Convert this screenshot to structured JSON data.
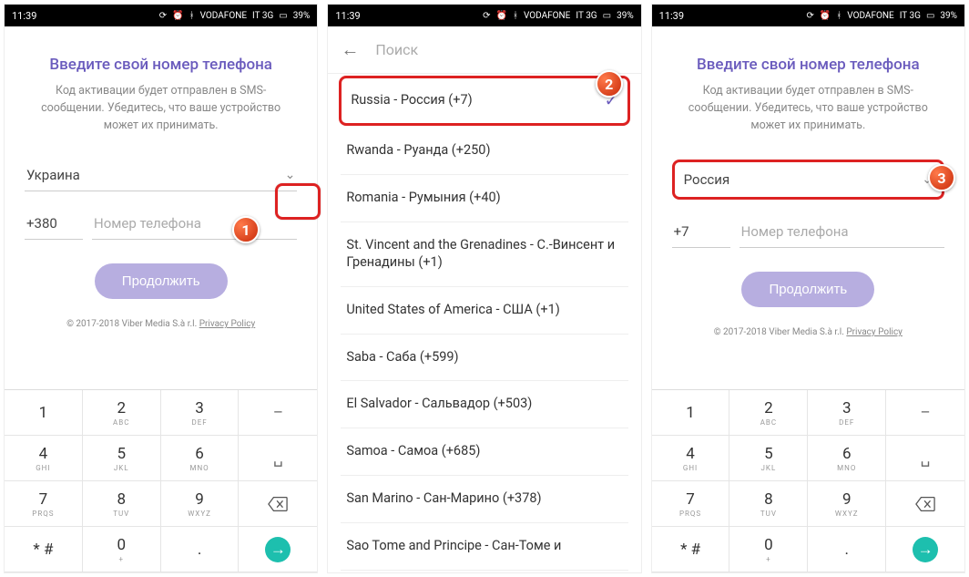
{
  "status": {
    "time": "11:39",
    "carrier": "VODAFONE",
    "network": "IT 3G",
    "battery": "39%"
  },
  "screen1": {
    "title": "Введите свой номер телефона",
    "subtitle": "Код активации будет отправлен в SMS-сообщении. Убедитесь, что ваше устройство может их принимать.",
    "country": "Украина",
    "code": "+380",
    "phone_placeholder": "Номер телефона",
    "continue": "Продолжить",
    "copyright": "© 2017-2018 Viber Media S.à r.l.",
    "privacy": "Privacy Policy",
    "badge": "1"
  },
  "screen2": {
    "search_placeholder": "Поиск",
    "items": [
      "Russia - Россия (+7)",
      "Rwanda - Руанда (+250)",
      "Romania - Румыния (+40)",
      "St. Vincent and the Grenadines - С.-Винсент и Гренадины (+1)",
      "United States of America - США (+1)",
      "Saba - Саба (+599)",
      "El Salvador - Сальвадор (+503)",
      "Samoa - Самоа (+685)",
      "San Marino - Сан-Марино (+378)",
      "Sao Tome and Principe - Сан-Томе и"
    ],
    "badge": "2"
  },
  "screen3": {
    "title": "Введите свой номер телефона",
    "subtitle": "Код активации будет отправлен в SMS-сообщении. Убедитесь, что ваше устройство может их принимать.",
    "country": "Россия",
    "code": "+7",
    "phone_placeholder": "Номер телефона",
    "continue": "Продолжить",
    "copyright": "© 2017-2018 Viber Media S.à r.l.",
    "privacy": "Privacy Policy",
    "badge": "3"
  },
  "keypad": {
    "keys": [
      {
        "main": "1",
        "sub": ""
      },
      {
        "main": "2",
        "sub": "ABC"
      },
      {
        "main": "3",
        "sub": "DEF"
      },
      {
        "main": "–",
        "sub": ""
      },
      {
        "main": "4",
        "sub": "GHI"
      },
      {
        "main": "5",
        "sub": "JKL"
      },
      {
        "main": "6",
        "sub": "MNO"
      },
      {
        "main": "␣",
        "sub": ""
      },
      {
        "main": "7",
        "sub": "PRQS"
      },
      {
        "main": "8",
        "sub": "TUV"
      },
      {
        "main": "9",
        "sub": "WXYZ"
      },
      {
        "main": "⌫",
        "sub": ""
      },
      {
        "main": "*  #",
        "sub": ""
      },
      {
        "main": "0",
        "sub": "+"
      },
      {
        "main": ".",
        "sub": ""
      },
      {
        "main": "→",
        "sub": ""
      }
    ]
  }
}
